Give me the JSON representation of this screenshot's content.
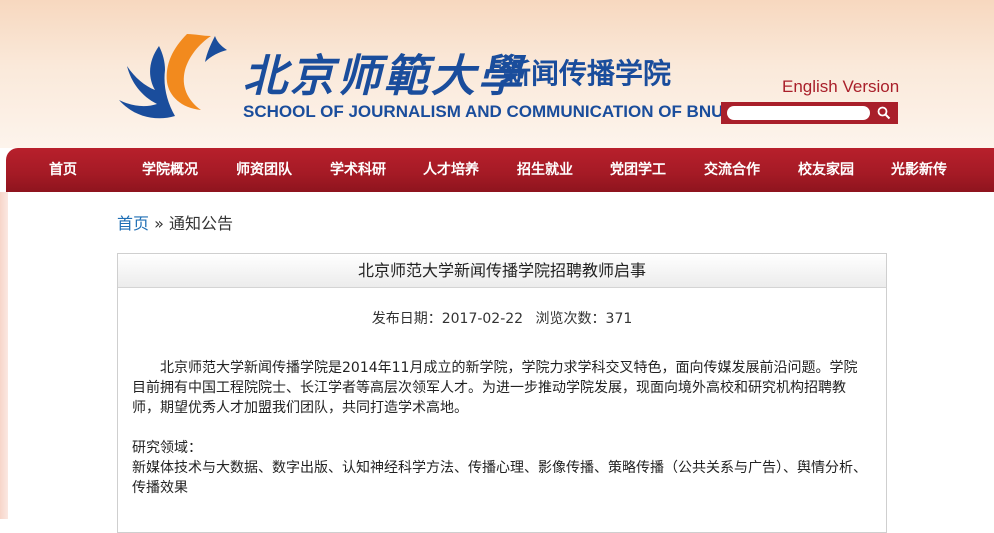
{
  "header": {
    "cn_name": "北京师範大學",
    "cn_school": "新闻传播学院",
    "en_name": "SCHOOL OF JOURNALISM AND COMMUNICATION OF BNU",
    "english_link": "English Version",
    "search": {
      "value": "",
      "placeholder": ""
    }
  },
  "nav": {
    "items": [
      "首页",
      "学院概况",
      "师资团队",
      "学术科研",
      "人才培养",
      "招生就业",
      "党团学工",
      "交流合作",
      "校友家园",
      "光影新传"
    ]
  },
  "breadcrumb": {
    "home": "首页",
    "sep": "»",
    "current": "通知公告"
  },
  "article": {
    "title": "北京师范大学新闻传播学院招聘教师启事",
    "date_label": "发布日期：",
    "date": "2017-02-22",
    "views_label": "浏览次数：",
    "views": "371",
    "paragraph1": "北京师范大学新闻传播学院是2014年11月成立的新学院，学院力求学科交叉特色，面向传媒发展前沿问题。学院目前拥有中国工程院院士、长江学者等高层次领军人才。为进一步推动学院发展，现面向境外高校和研究机构招聘教师，期望优秀人才加盟我们团队，共同打造学术高地。",
    "research_label": "研究领域：",
    "research_areas": "新媒体技术与大数据、数字出版、认知神经科学方法、传播心理、影像传播、策略传播（公共关系与广告）、舆情分析、传播效果"
  },
  "colors": {
    "brand_blue": "#1a4d9c",
    "brand_red": "#a91f2a",
    "logo_orange": "#f28a1e",
    "link_blue": "#1f6fb5"
  },
  "icons": {
    "logo": "bnu-phoenix-logo-icon",
    "search": "search-icon"
  }
}
